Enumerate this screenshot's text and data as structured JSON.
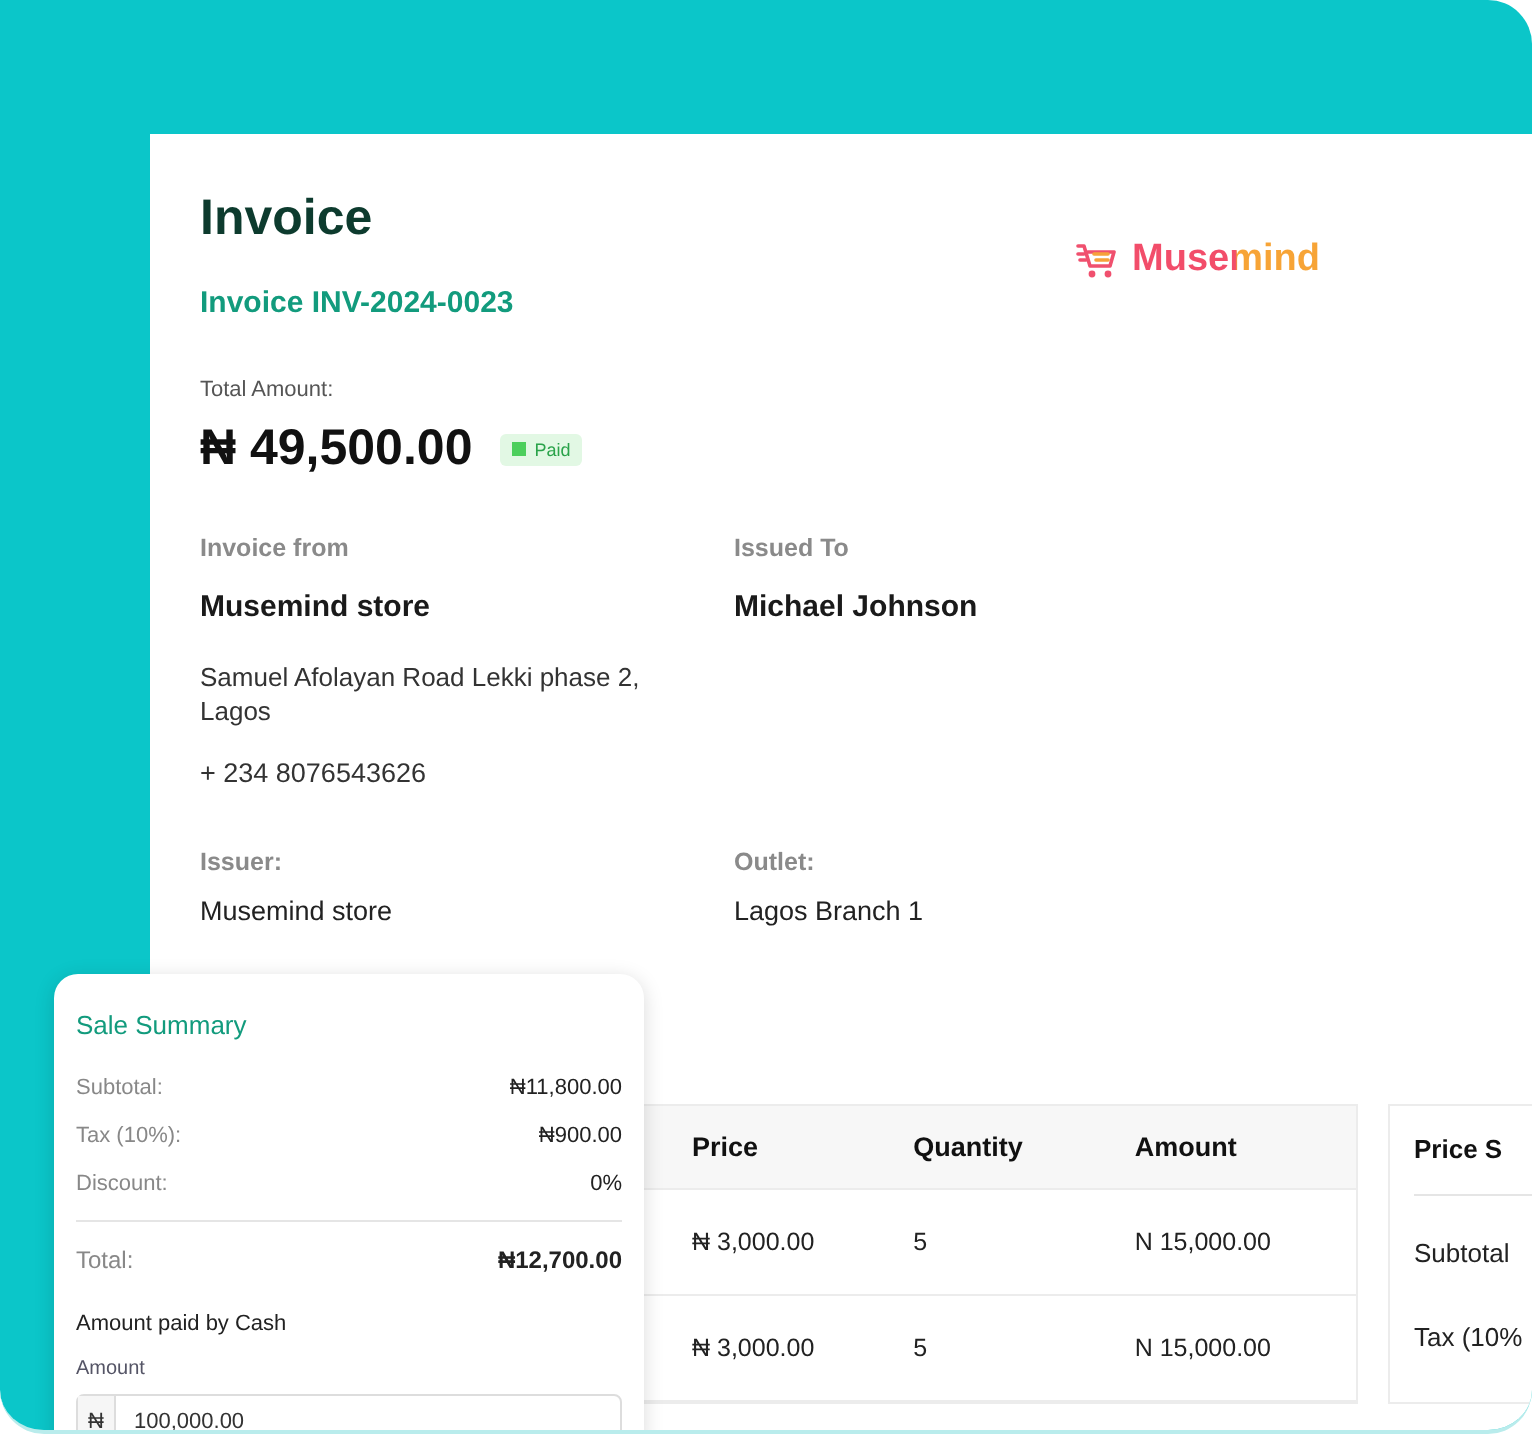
{
  "header": {
    "title": "Invoice",
    "invoice_number": "Invoice INV-2024-0023",
    "logo_text": "Musemind"
  },
  "total": {
    "label": "Total Amount:",
    "amount": "₦ 49,500.00",
    "status": "Paid",
    "paid": true
  },
  "parties": [
    {
      "label": "Invoice from",
      "name": "Musemind store",
      "address": "Samuel Afolayan Road Lekki phase 2, Lagos",
      "phone": "+ 234 8076543626"
    },
    {
      "label": "Issued To",
      "name": "Michael Johnson"
    }
  ],
  "details": [
    {
      "label": "Issuer:",
      "value": "Musemind store"
    },
    {
      "label": "Outlet:",
      "value": "Lagos Branch 1"
    }
  ],
  "table": {
    "columns": [
      "Price",
      "Quantity",
      "Amount"
    ],
    "rows": [
      [
        "₦ 3,000.00",
        "5",
        "N 15,000.00"
      ],
      [
        "₦ 3,000.00",
        "5",
        "N 15,000.00"
      ]
    ]
  },
  "price_summary": {
    "title": "Price S",
    "rows": [
      "Subtotal",
      "Tax (10%"
    ]
  },
  "sale_summary": {
    "title": "Sale Summary",
    "rows": [
      {
        "label": "Subtotal:",
        "value": "₦11,800.00"
      },
      {
        "label": "Tax (10%):",
        "value": "₦900.00"
      },
      {
        "label": "Discount:",
        "value": "0%"
      }
    ],
    "total": {
      "label": "Total:",
      "value": "₦12,700.00"
    },
    "payment_title": "Amount paid by Cash",
    "field_label": "Amount",
    "currency": "₦",
    "amount": "100,000.00"
  }
}
